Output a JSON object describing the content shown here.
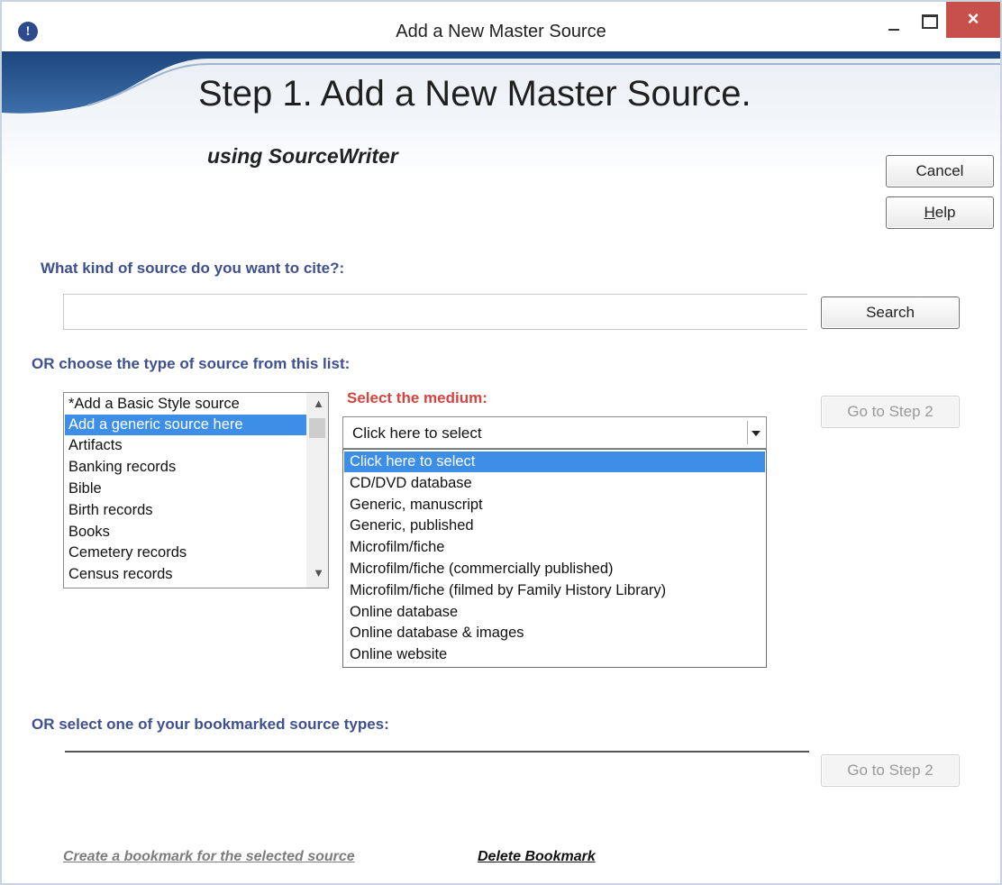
{
  "window": {
    "title": "Add a New Master Source",
    "app_icon": "info-icon",
    "close_glyph": "×"
  },
  "header": {
    "step_title": "Step 1.  Add a New Master Source.",
    "subtitle": "using SourceWriter"
  },
  "buttons": {
    "cancel": "Cancel",
    "help_prefix": "",
    "help_underlined": "H",
    "help_rest": "elp",
    "search": "Search",
    "go_to_step_2": "Go to Step 2"
  },
  "search": {
    "question": "What kind of source do you want to cite?:",
    "value": ""
  },
  "source_list": {
    "label": "OR choose the type of source from this list:",
    "items": [
      "*Add a Basic Style source",
      "Add a generic source here",
      "Artifacts",
      "Banking records",
      "Bible",
      "Birth records",
      "Books",
      "Cemetery records",
      "Census records"
    ],
    "selected_index": 1,
    "scroll_up": "^",
    "scroll_down": "v"
  },
  "medium": {
    "label": "Select the medium:",
    "selected_value": "Click here to select",
    "options": [
      "Click here to select",
      "CD/DVD database",
      "Generic, manuscript",
      "Generic, published",
      "Microfilm/fiche",
      "Microfilm/fiche (commercially published)",
      "Microfilm/fiche (filmed by Family History Library)",
      "Online database",
      "Online database & images",
      "Online website"
    ],
    "highlighted_index": 0
  },
  "bookmarks": {
    "label": "OR select one of your bookmarked source types:",
    "create_link": "Create a bookmark for the selected source",
    "delete_link": "Delete Bookmark"
  },
  "colors": {
    "selection": "#3d8ee6",
    "label_blue": "#3f4f8f",
    "label_red": "#d9433f",
    "close_button": "#c7504a",
    "banner_accent": "#234e8c"
  }
}
